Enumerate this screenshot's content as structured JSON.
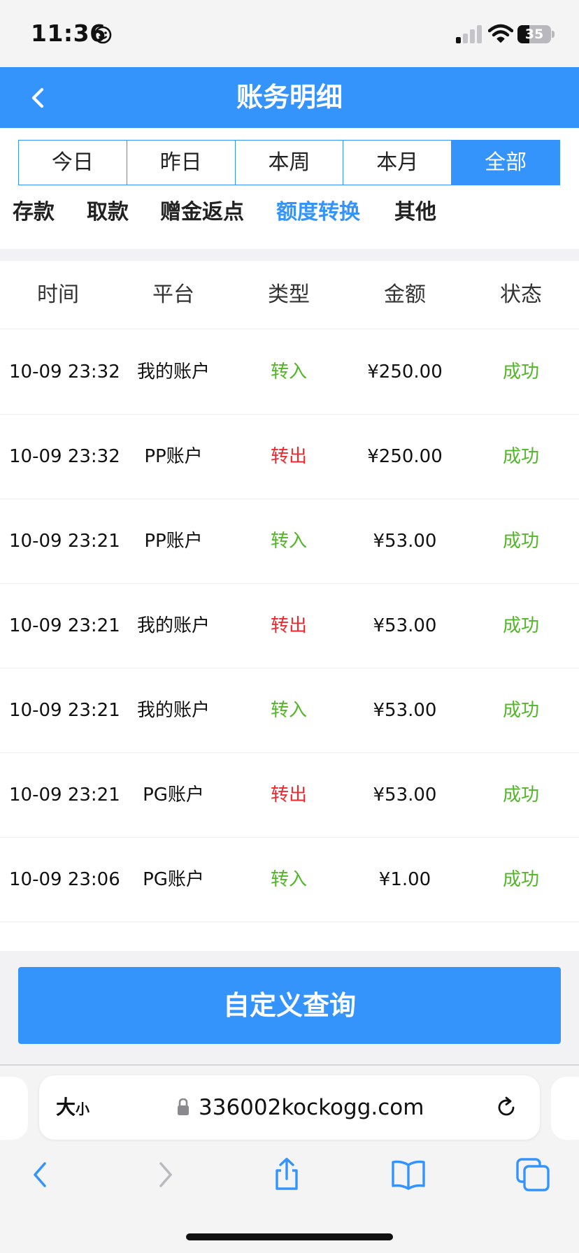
{
  "status_bar": {
    "time": "11:36",
    "battery_level": "35",
    "icons": [
      "smiley-icon",
      "cellular-signal-icon",
      "wifi-icon",
      "battery-icon"
    ]
  },
  "header": {
    "title": "账务明细",
    "back_icon": "chevron-left-icon"
  },
  "period_tabs": [
    {
      "label": "今日",
      "active": false
    },
    {
      "label": "昨日",
      "active": false
    },
    {
      "label": "本周",
      "active": false
    },
    {
      "label": "本月",
      "active": false
    },
    {
      "label": "全部",
      "active": true
    }
  ],
  "category_tabs": [
    {
      "label": "存款",
      "active": false
    },
    {
      "label": "取款",
      "active": false
    },
    {
      "label": "赠金返点",
      "active": false
    },
    {
      "label": "额度转换",
      "active": true
    },
    {
      "label": "其他",
      "active": false
    }
  ],
  "table": {
    "columns": [
      "时间",
      "平台",
      "类型",
      "金额",
      "状态"
    ],
    "rows": [
      {
        "time": "10-09 23:32",
        "platform": "我的账户",
        "type": "转入",
        "amount": "¥250.00",
        "status": "成功"
      },
      {
        "time": "10-09 23:32",
        "platform": "PP账户",
        "type": "转出",
        "amount": "¥250.00",
        "status": "成功"
      },
      {
        "time": "10-09 23:21",
        "platform": "PP账户",
        "type": "转入",
        "amount": "¥53.00",
        "status": "成功"
      },
      {
        "time": "10-09 23:21",
        "platform": "我的账户",
        "type": "转出",
        "amount": "¥53.00",
        "status": "成功"
      },
      {
        "time": "10-09 23:21",
        "platform": "我的账户",
        "type": "转入",
        "amount": "¥53.00",
        "status": "成功"
      },
      {
        "time": "10-09 23:21",
        "platform": "PG账户",
        "type": "转出",
        "amount": "¥53.00",
        "status": "成功"
      },
      {
        "time": "10-09 23:06",
        "platform": "PG账户",
        "type": "转入",
        "amount": "¥1.00",
        "status": "成功"
      }
    ]
  },
  "query_button": {
    "label": "自定义查询"
  },
  "browser": {
    "text_size_label_big": "大",
    "text_size_label_small": "小",
    "url": "336002kockogg.com",
    "toolbar_icons": [
      "back-icon",
      "forward-icon",
      "share-icon",
      "bookmarks-icon",
      "tabs-icon"
    ]
  },
  "colors": {
    "accent": "#3594fc",
    "transfer_in": "#52b726",
    "transfer_out": "#f0282d",
    "success": "#52b726"
  }
}
